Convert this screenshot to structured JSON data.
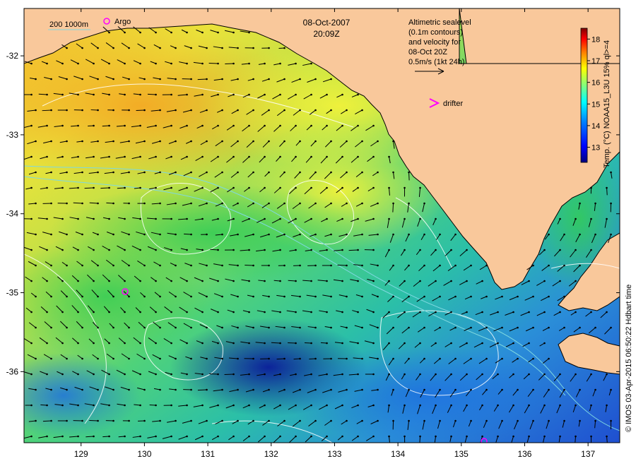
{
  "header": {
    "date": "08-Oct-2007",
    "time": "20:09Z"
  },
  "legend": {
    "depth_contours": "200  1000m",
    "argo_label": "Argo",
    "drifter_label": "drifter"
  },
  "annotation": {
    "lines": [
      "Altimetric sealevel",
      "(0.1m contours)",
      "and velocity for",
      "08-Oct 20Z",
      "0.5m/s (1kt 24h)"
    ]
  },
  "colorbar": {
    "label": "Temp. (°C) NOAA15_L3U 15% ql>=4",
    "ticks": [
      "18",
      "17",
      "16",
      "15",
      "14",
      "13"
    ],
    "range": [
      12.3,
      18.5
    ],
    "colors": [
      "#00007f",
      "#0000ff",
      "#007fff",
      "#00ffff",
      "#7fff7f",
      "#ffff00",
      "#ff7f00",
      "#ff0000",
      "#7f0000"
    ]
  },
  "credit": "© IMOS 03-Apr-2015 06:50:22 Hdbart time",
  "axes": {
    "x_ticks": [
      "129",
      "130",
      "131",
      "132",
      "133",
      "134",
      "135",
      "136",
      "137"
    ],
    "y_ticks": [
      "-32",
      "-33",
      "-34",
      "-35",
      "-36"
    ],
    "lon_range": [
      128.1,
      137.5
    ],
    "lat_range": [
      -36.9,
      -31.4
    ]
  },
  "colors": {
    "land": "#f9c89b",
    "contour_white": "#ffffff",
    "contour_cyan": "#7fd8e0",
    "marker": "#ff00ff",
    "arrow": "#000000"
  }
}
